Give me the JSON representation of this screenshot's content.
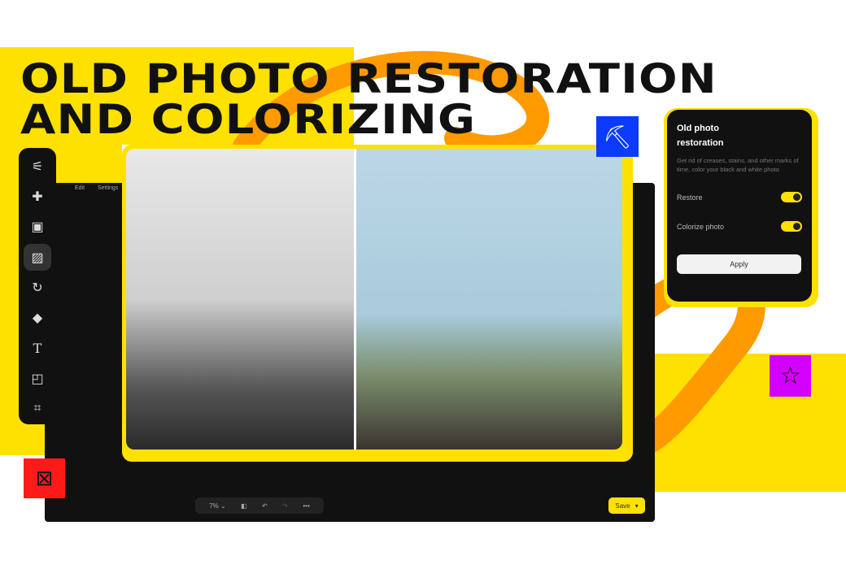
{
  "headline": {
    "line1": "OLD PHOTO RESTORATION",
    "line2": "AND COLORIZING"
  },
  "editor": {
    "menu": [
      "Edit",
      "Settings"
    ],
    "zoom": "7%",
    "save_label": "Save"
  },
  "toolbar": {
    "tools": [
      "adjust-sliders-icon",
      "bandage-icon",
      "portrait-icon",
      "photo-enhance-icon",
      "rotate-sparkle-icon",
      "magic-wand-icon",
      "text-icon",
      "frame-icon",
      "crop-icon"
    ],
    "active_index": 3
  },
  "panel": {
    "title": "Old photo restoration",
    "description": "Get rid of creases, stains, and other marks of time, color your black and white photo",
    "options": [
      {
        "label": "Restore",
        "enabled": true
      },
      {
        "label": "Colorize photo",
        "enabled": true
      }
    ],
    "apply_label": "Apply"
  },
  "colors": {
    "brand_yellow": "#ffe100",
    "accent_orange": "#ff9a00",
    "blue": "#0b3bff",
    "magenta": "#d400ff",
    "red": "#ff1a1a"
  }
}
